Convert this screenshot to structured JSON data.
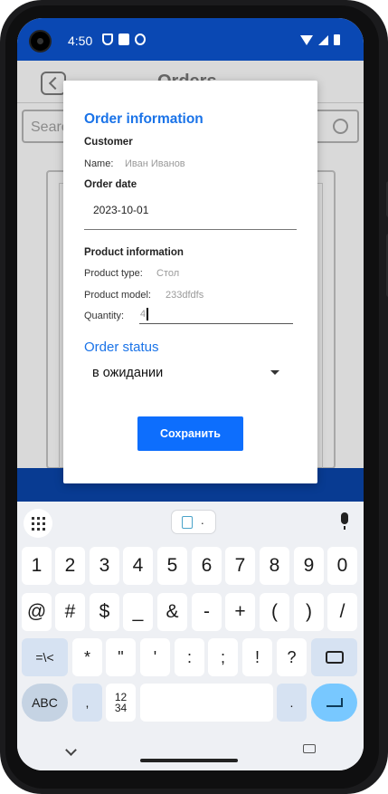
{
  "status_bar": {
    "time": "4:50"
  },
  "app": {
    "title": "Orders",
    "search_placeholder": "Search"
  },
  "dialog": {
    "heading": "Order information",
    "customer_label": "Customer",
    "name_label": "Name:",
    "name_value": "Иван Иванов",
    "order_date_label": "Order date",
    "order_date_value": "2023-10-01",
    "product_info_label": "Product information",
    "product_type_label": "Product type:",
    "product_type_value": "Стол",
    "product_model_label": "Product model:",
    "product_model_value": "233dfdfs",
    "quantity_label": "Quantity:",
    "quantity_value": "4",
    "order_status_heading": "Order status",
    "order_status_value": "в ожидании",
    "save_label": "Сохранить"
  },
  "keyboard": {
    "clipboard_hint": ".",
    "row1": [
      "1",
      "2",
      "3",
      "4",
      "5",
      "6",
      "7",
      "8",
      "9",
      "0"
    ],
    "row2": [
      "@",
      "#",
      "$",
      "_",
      "&",
      "-",
      "+",
      "(",
      ")",
      "/"
    ],
    "row3_mod": "=\\<",
    "row3": [
      "*",
      "\"",
      "'",
      ":",
      ";",
      "!",
      "?"
    ],
    "abc_label": "ABC",
    "comma": ",",
    "numpad_top": "12",
    "numpad_bottom": "34",
    "period": "."
  },
  "colors": {
    "primary_blue": "#0a48b3",
    "accent_blue": "#1a73e8",
    "button_blue": "#0d6efd"
  }
}
